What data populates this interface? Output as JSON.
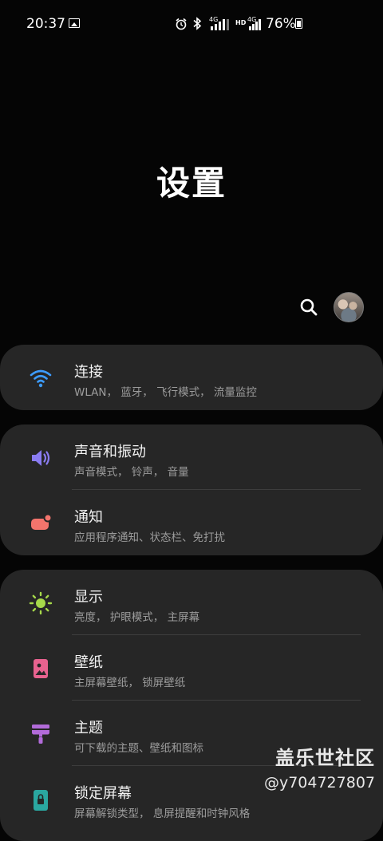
{
  "status_bar": {
    "time": "20:37",
    "battery_percent": "76%",
    "network_1": "4G",
    "network_2": "HD",
    "network_3": "4G"
  },
  "header": {
    "title": "设置"
  },
  "groups": [
    {
      "items": [
        {
          "title": "连接",
          "subtitle": "WLAN， 蓝牙， 飞行模式， 流量监控",
          "icon": "wifi-icon",
          "color": "#3d9cff"
        }
      ]
    },
    {
      "items": [
        {
          "title": "声音和振动",
          "subtitle": "声音模式， 铃声， 音量",
          "icon": "volume-icon",
          "color": "#8a7cf2"
        },
        {
          "title": "通知",
          "subtitle": "应用程序通知、状态栏、免打扰",
          "icon": "notification-icon",
          "color": "#f3746c"
        }
      ]
    },
    {
      "items": [
        {
          "title": "显示",
          "subtitle": "亮度， 护眼模式， 主屏幕",
          "icon": "brightness-icon",
          "color": "#a6d94a"
        },
        {
          "title": "壁纸",
          "subtitle": "主屏幕壁纸， 锁屏壁纸",
          "icon": "wallpaper-icon",
          "color": "#e8628f"
        },
        {
          "title": "主题",
          "subtitle": "可下载的主题、壁纸和图标",
          "icon": "theme-brush-icon",
          "color": "#b26bd9"
        },
        {
          "title": "锁定屏幕",
          "subtitle": "屏幕解锁类型， 息屏提醒和时钟风格",
          "icon": "lock-screen-icon",
          "color": "#2aa7a0"
        }
      ]
    }
  ],
  "watermark": {
    "line1": "盖乐世社区",
    "line2": "@y704727807"
  }
}
